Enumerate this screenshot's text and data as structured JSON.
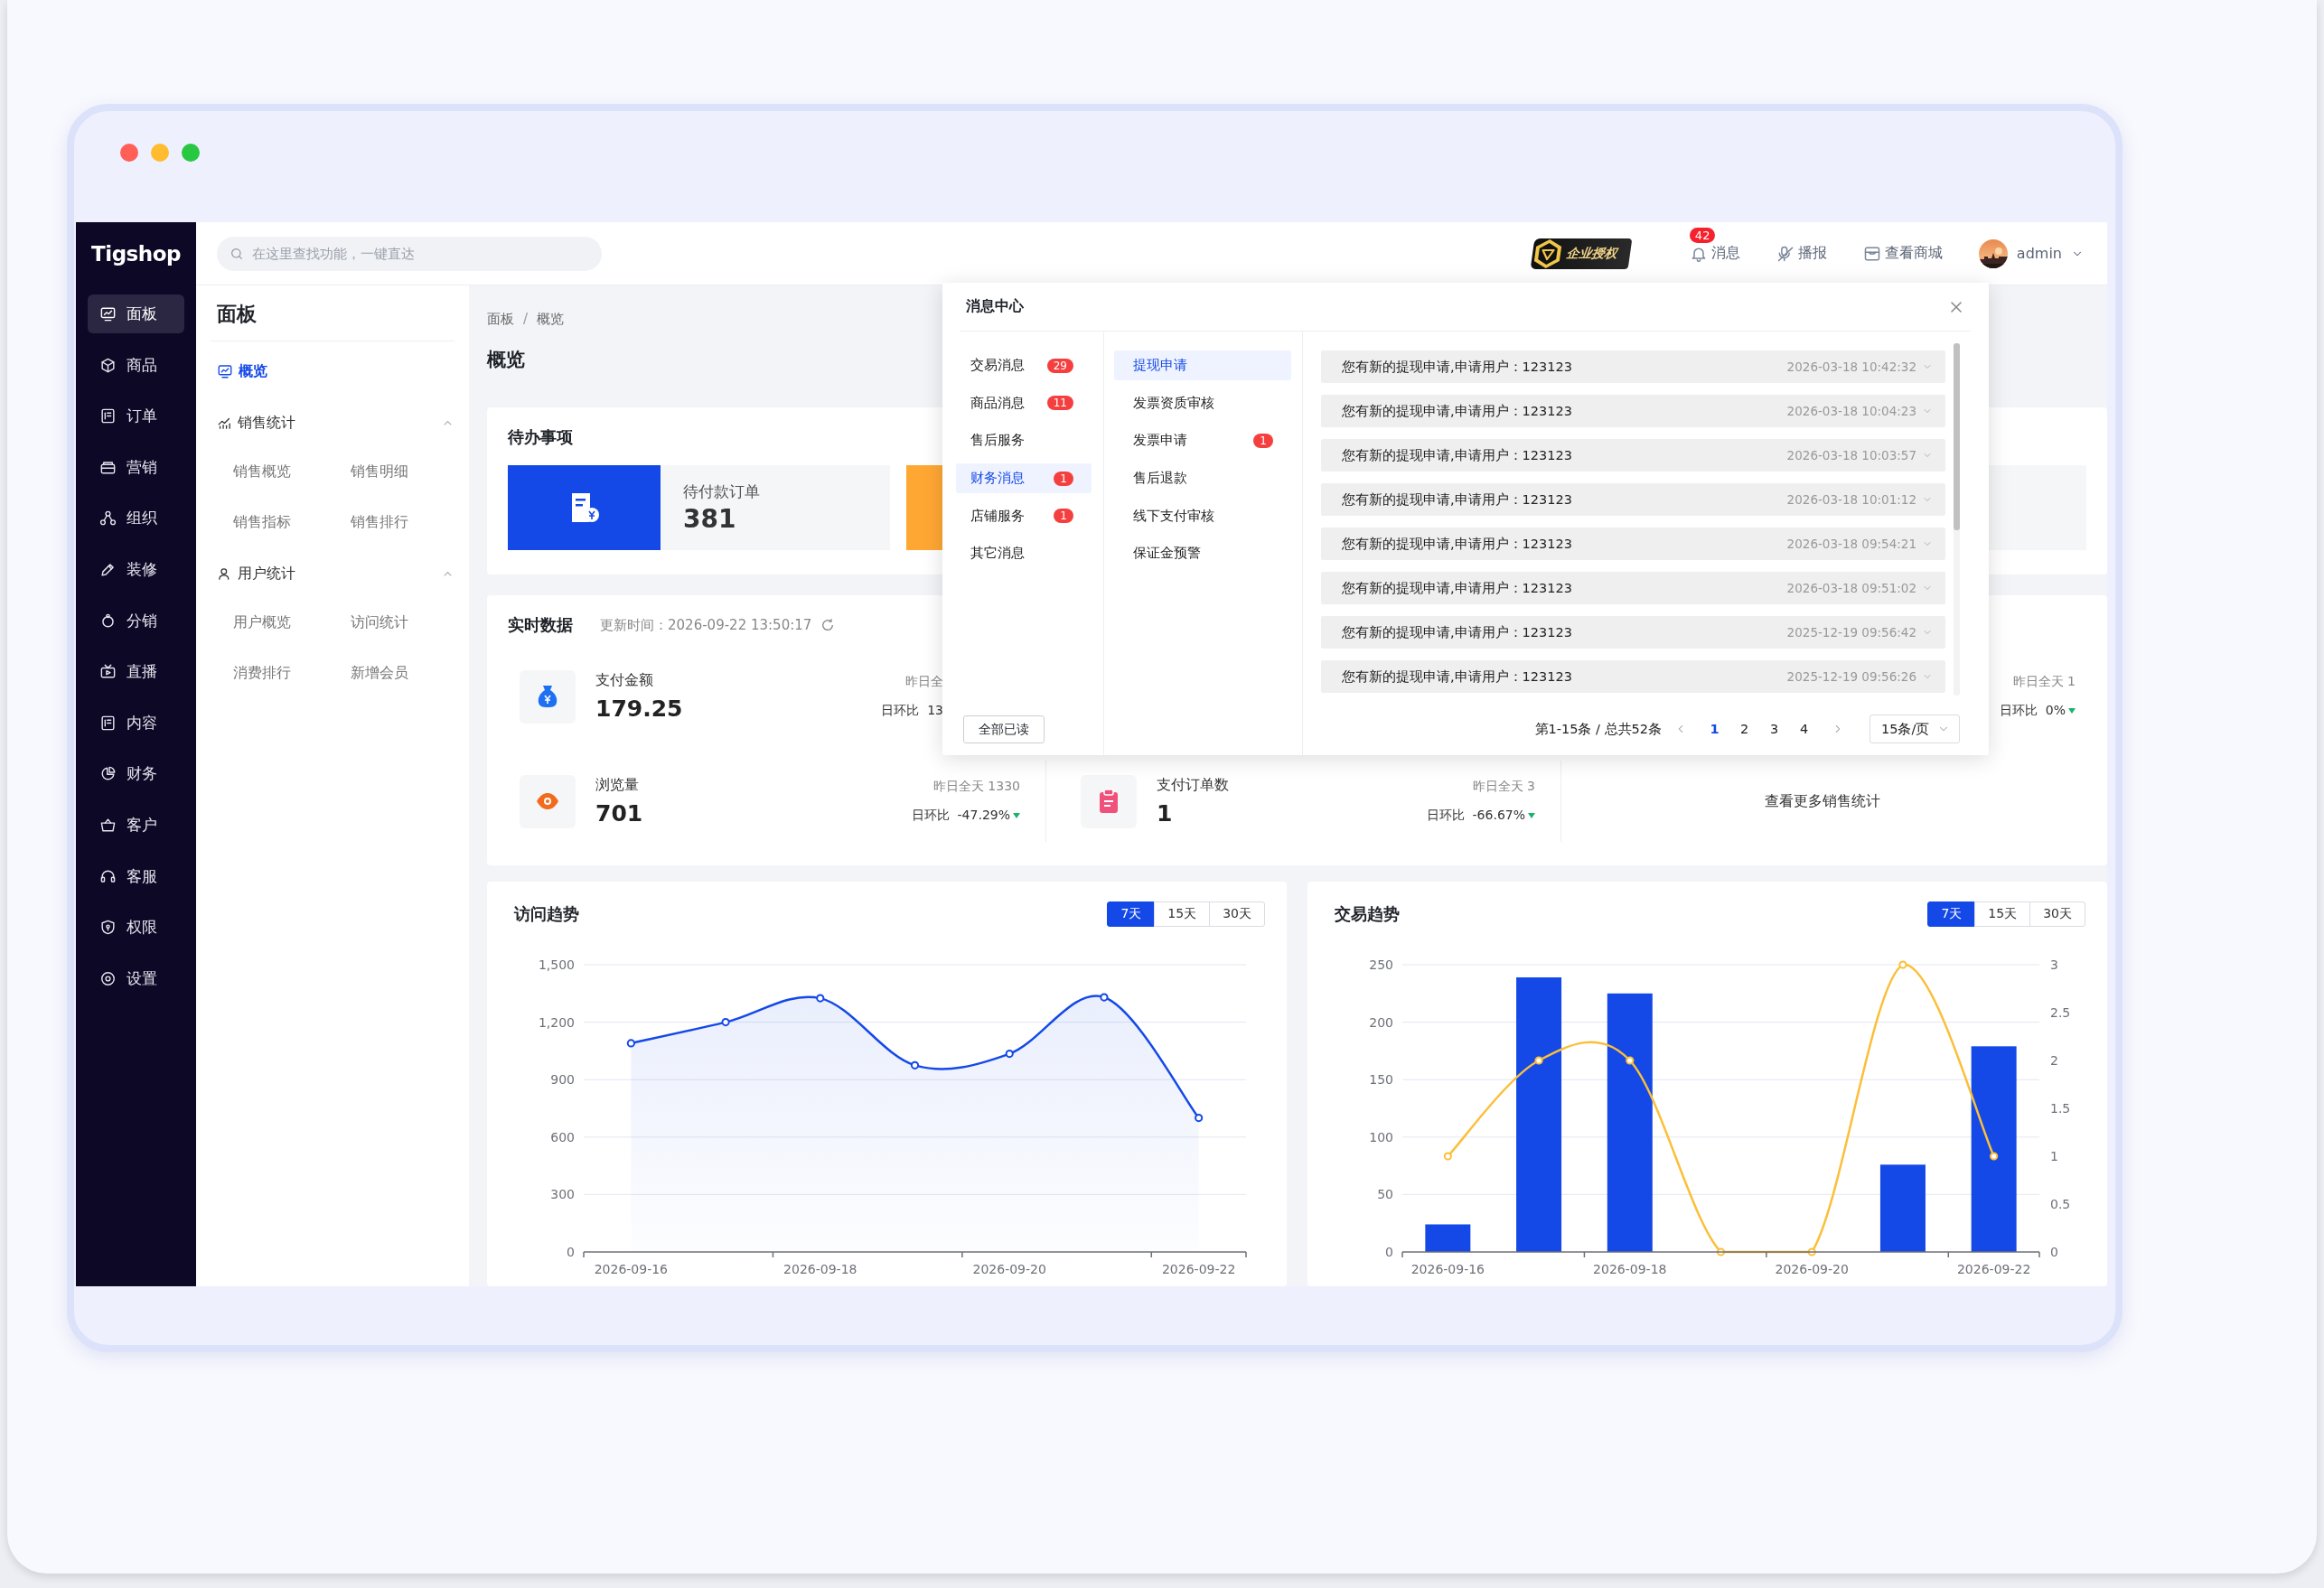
{
  "sidebar": {
    "logo": "Tigshop",
    "items": [
      {
        "label": "面板",
        "selected": true
      },
      {
        "label": "商品",
        "selected": false
      },
      {
        "label": "订单",
        "selected": false
      },
      {
        "label": "营销",
        "selected": false
      },
      {
        "label": "组织",
        "selected": false
      },
      {
        "label": "装修",
        "selected": false
      },
      {
        "label": "分销",
        "selected": false
      },
      {
        "label": "直播",
        "selected": false
      },
      {
        "label": "内容",
        "selected": false
      },
      {
        "label": "财务",
        "selected": false
      },
      {
        "label": "客户",
        "selected": false
      },
      {
        "label": "客服",
        "selected": false
      },
      {
        "label": "权限",
        "selected": false
      },
      {
        "label": "设置",
        "selected": false
      }
    ]
  },
  "header": {
    "search": {
      "placeholder": "在这里查找功能，一键直达"
    },
    "license_badge": "企业授权",
    "notifications": {
      "label": "消息",
      "count": "42"
    },
    "actions": [
      {
        "label": "播报"
      },
      {
        "label": "查看商城"
      }
    ],
    "user": {
      "name": "admin"
    }
  },
  "submenu": {
    "title": "面板",
    "items": [
      {
        "label": "概览",
        "selected": true
      }
    ],
    "groups": [
      {
        "label": "销售统计",
        "expanded": true,
        "items": [
          "销售概览",
          "销售明细",
          "销售指标",
          "销售排行"
        ]
      },
      {
        "label": "用户统计",
        "expanded": true,
        "items": [
          "用户概览",
          "访问统计",
          "消费排行",
          "新增会员"
        ]
      }
    ]
  },
  "breadcrumb": {
    "items": [
      "面板",
      "概览"
    ],
    "separator": "/"
  },
  "page_title": "概览",
  "todo": {
    "title": "待办事项",
    "items": [
      {
        "label": "待付款订单",
        "count": "381",
        "color": "#1449e8"
      },
      {
        "color": "#ffa733"
      }
    ]
  },
  "realtime": {
    "title": "实时数据",
    "updated": "更新时间：2026-09-22 13:50:17",
    "rows": [
      [
        {
          "label": "支付金额",
          "value": "179.25",
          "yesterday": {
            "label": "昨日全"
          },
          "ratio": {
            "label": "日环比",
            "value": "13"
          }
        },
        {
          "yesterday": {
            "label": "昨日全天",
            "value": "1"
          },
          "ratio": {
            "label": "日环比",
            "value": "0%",
            "falling": true
          }
        }
      ],
      [
        {
          "label": "浏览量",
          "value": "701",
          "yesterday": {
            "label": "昨日全天",
            "value": "1330"
          },
          "ratio": {
            "label": "日环比",
            "value": "-47.29%",
            "falling": true
          }
        },
        {
          "label": "支付订单数",
          "value": "1",
          "yesterday": {
            "label": "昨日全天",
            "value": "3"
          },
          "ratio": {
            "label": "日环比",
            "value": "-66.67%",
            "falling": true
          }
        }
      ]
    ],
    "more_link": "查看更多销售统计"
  },
  "visit_trend": {
    "title": "访问趋势",
    "ranges": [
      {
        "label": "7天",
        "selected": true
      },
      {
        "label": "15天",
        "selected": false
      },
      {
        "label": "30天",
        "selected": false
      }
    ],
    "chart_data": {
      "type": "area",
      "categories": [
        "2026-09-16",
        null,
        "2026-09-18",
        null,
        "2026-09-20",
        null,
        "2026-09-22"
      ],
      "grid": true,
      "series": [
        {
          "color": "#1449e8",
          "marker": true,
          "values": [
            1090,
            1200,
            1325,
            975,
            1035,
            1330,
            700
          ]
        }
      ],
      "ylim": [
        0,
        1500
      ],
      "yticks": [
        {
          "value": 0,
          "label": "0"
        },
        {
          "value": 300,
          "label": "300"
        },
        {
          "value": 600,
          "label": "600"
        },
        {
          "value": 900,
          "label": "900"
        },
        {
          "value": 1200,
          "label": "1,200"
        },
        {
          "value": 1500,
          "label": "1,500"
        }
      ]
    }
  },
  "trade_trend": {
    "title": "交易趋势",
    "ranges": [
      {
        "label": "7天",
        "selected": true
      },
      {
        "label": "15天",
        "selected": false
      },
      {
        "label": "30天",
        "selected": false
      }
    ],
    "chart_data": {
      "type": "bar",
      "categories": [
        "2026-09-16",
        null,
        "2026-09-18",
        null,
        "2026-09-20",
        null,
        "2026-09-22"
      ],
      "grid": true,
      "series": [
        {
          "color": "#1449e8",
          "values": [
            24,
            239,
            225,
            0,
            0,
            76,
            179
          ]
        },
        {
          "type": "line",
          "axis": "y2",
          "color": "#fbbf39",
          "marker": true,
          "values": [
            1,
            2,
            2,
            0,
            0,
            3,
            1
          ]
        }
      ],
      "ylim": [
        0,
        250
      ],
      "yticks": [
        0,
        50,
        100,
        150,
        200,
        250
      ],
      "y2lim": [
        0,
        3
      ],
      "y2ticks": [
        {
          "value": 0,
          "label": "0"
        },
        {
          "value": 0.5,
          "label": "0.5"
        },
        {
          "value": 1,
          "label": "1"
        },
        {
          "value": 1.5,
          "label": "1.5"
        },
        {
          "value": 2,
          "label": "2"
        },
        {
          "value": 2.5,
          "label": "2.5"
        },
        {
          "value": 3,
          "label": "3"
        }
      ]
    }
  },
  "message_center": {
    "title": "消息中心",
    "categories": [
      {
        "label": "交易消息",
        "count": "29",
        "selected": false
      },
      {
        "label": "商品消息",
        "count": "11",
        "selected": false
      },
      {
        "label": "售后服务",
        "selected": false
      },
      {
        "label": "财务消息",
        "count": "1",
        "selected": true
      },
      {
        "label": "店铺服务",
        "count": "1",
        "selected": false
      },
      {
        "label": "其它消息",
        "selected": false
      }
    ],
    "mark_all_read": "全部已读",
    "subcategories": [
      {
        "label": "提现申请",
        "selected": true
      },
      {
        "label": "发票资质审核",
        "selected": false
      },
      {
        "label": "发票申请",
        "count": "1",
        "selected": false
      },
      {
        "label": "售后退款",
        "selected": false
      },
      {
        "label": "线下支付审核",
        "selected": false
      },
      {
        "label": "保证金预警",
        "selected": false
      }
    ],
    "messages": [
      {
        "text": "您有新的提现申请,申请用户：123123",
        "time": "2026-03-18 10:42:32"
      },
      {
        "text": "您有新的提现申请,申请用户：123123",
        "time": "2026-03-18 10:04:23"
      },
      {
        "text": "您有新的提现申请,申请用户：123123",
        "time": "2026-03-18 10:03:57"
      },
      {
        "text": "您有新的提现申请,申请用户：123123",
        "time": "2026-03-18 10:01:12"
      },
      {
        "text": "您有新的提现申请,申请用户：123123",
        "time": "2026-03-18 09:54:21"
      },
      {
        "text": "您有新的提现申请,申请用户：123123",
        "time": "2026-03-18 09:51:02"
      },
      {
        "text": "您有新的提现申请,申请用户：123123",
        "time": "2025-12-19 09:56:42"
      },
      {
        "text": "您有新的提现申请,申请用户：123123",
        "time": "2025-12-19 09:56:26"
      }
    ],
    "pagination": {
      "summary": "第1-15条 / 总共52条",
      "pages": [
        {
          "label": "1",
          "selected": true
        },
        {
          "label": "2",
          "selected": false
        },
        {
          "label": "3",
          "selected": false
        },
        {
          "label": "4",
          "selected": false
        }
      ],
      "page_size": "15条/页"
    }
  }
}
